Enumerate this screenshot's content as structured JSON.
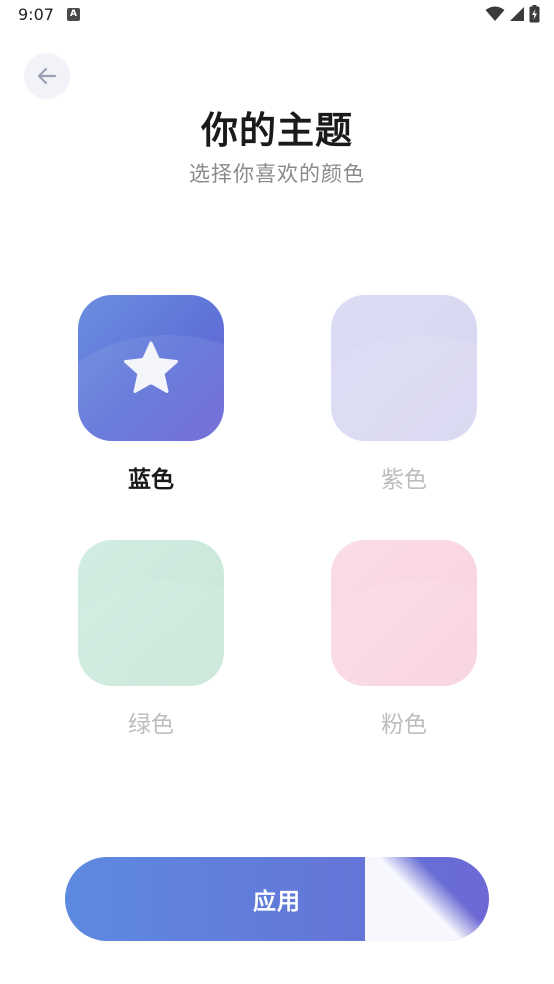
{
  "status_bar": {
    "time": "9:07",
    "notification_icon": "A",
    "icons": [
      "wifi-icon",
      "signal-icon",
      "battery-charging-icon"
    ]
  },
  "header": {
    "back_icon": "arrow-left-icon",
    "title": "你的主题",
    "subtitle": "选择你喜欢的颜色"
  },
  "themes": [
    {
      "label": "蓝色",
      "selected": true,
      "color": "#6378d9",
      "icon": "star-icon"
    },
    {
      "label": "紫色",
      "selected": false,
      "color": "#d9d8f2"
    },
    {
      "label": "绿色",
      "selected": false,
      "color": "#cde9dc"
    },
    {
      "label": "粉色",
      "selected": false,
      "color": "#f9d6e2"
    }
  ],
  "apply_button": {
    "label": "应用"
  },
  "colors": {
    "accent": "#6378d9",
    "title": "#1a1a1a",
    "subtitle": "#8a8a8a",
    "muted_label": "#bdbdbd"
  }
}
